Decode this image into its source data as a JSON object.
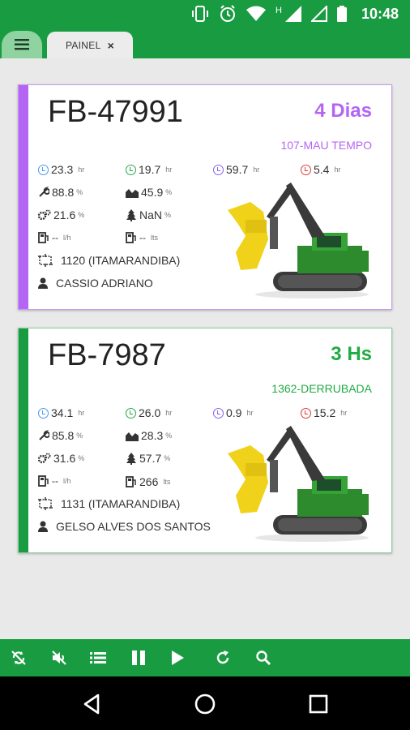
{
  "status_bar": {
    "time": "10:48",
    "network_label": "H"
  },
  "tab": {
    "label": "PAINEL",
    "close_label": "×"
  },
  "cards": [
    {
      "id": "FB-47991",
      "duration": "4 Dias",
      "activity": "107-MAU TEMPO",
      "accent_color": "#b565f3",
      "timers": [
        {
          "value": "23.3",
          "unit": "hr"
        },
        {
          "value": "19.7",
          "unit": "hr"
        },
        {
          "value": "59.7",
          "unit": "hr"
        },
        {
          "value": "5.4",
          "unit": "hr"
        }
      ],
      "wrench": {
        "value": "88.8",
        "unit": "%"
      },
      "chart": {
        "value": "45.9",
        "unit": "%"
      },
      "gears": {
        "value": "21.6",
        "unit": "%"
      },
      "tree": {
        "value": "NaN",
        "unit": "%"
      },
      "fuel_rate": {
        "value": "--",
        "unit": "l/h"
      },
      "fuel_total": {
        "value": "--",
        "unit": "lts"
      },
      "location": "1120 (ITAMARANDIBA)",
      "operator": "CASSIO ADRIANO"
    },
    {
      "id": "FB-7987",
      "duration": "3 Hs",
      "activity": "1362-DERRUBADA",
      "accent_color": "#199c41",
      "timers": [
        {
          "value": "34.1",
          "unit": "hr"
        },
        {
          "value": "26.0",
          "unit": "hr"
        },
        {
          "value": "0.9",
          "unit": "hr"
        },
        {
          "value": "15.2",
          "unit": "hr"
        }
      ],
      "wrench": {
        "value": "85.8",
        "unit": "%"
      },
      "chart": {
        "value": "28.3",
        "unit": "%"
      },
      "gears": {
        "value": "31.6",
        "unit": "%"
      },
      "tree": {
        "value": "57.7",
        "unit": "%"
      },
      "fuel_rate": {
        "value": "--",
        "unit": "l/h"
      },
      "fuel_total": {
        "value": "266",
        "unit": "lts"
      },
      "location": "1131 (ITAMARANDIBA)",
      "operator": "GELSO ALVES DOS SANTOS"
    }
  ],
  "toolbar_icons": [
    "sync-disabled-icon",
    "mute-icon",
    "list-icon",
    "pause-icon",
    "play-icon",
    "refresh-icon",
    "search-icon"
  ],
  "nav_icons": [
    "back-icon",
    "home-icon",
    "recents-icon"
  ]
}
